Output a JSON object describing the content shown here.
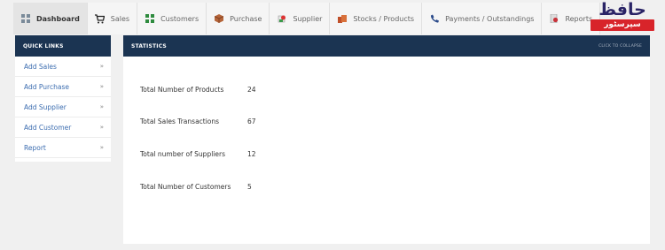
{
  "nav": {
    "tabs": [
      {
        "label": "Dashboard",
        "icon": "dashboard-grid-icon",
        "active": true
      },
      {
        "label": "Sales",
        "icon": "cart-icon"
      },
      {
        "label": "Customers",
        "icon": "customers-icon"
      },
      {
        "label": "Purchase",
        "icon": "box-icon"
      },
      {
        "label": "Supplier",
        "icon": "supplier-icon"
      },
      {
        "label": "Stocks / Products",
        "icon": "stock-boxes-icon"
      },
      {
        "label": "Payments / Outstandings",
        "icon": "phone-icon"
      },
      {
        "label": "Reports",
        "icon": "reports-icon"
      }
    ]
  },
  "logo": {
    "top": "حافظ",
    "bottom": "سپرسٹور"
  },
  "quick_links": {
    "title": "QUICK LINKS",
    "items": [
      {
        "label": "Add Sales",
        "chevron": "»"
      },
      {
        "label": "Add Purchase",
        "chevron": "»"
      },
      {
        "label": "Add Supplier",
        "chevron": "»"
      },
      {
        "label": "Add Customer",
        "chevron": "»"
      },
      {
        "label": "Report",
        "chevron": "»"
      }
    ]
  },
  "statistics": {
    "title": "STATISTICS",
    "collapse_label": "CLICK TO COLLAPSE",
    "rows": [
      {
        "label": "Total Number of Products",
        "value": "24"
      },
      {
        "label": "Total Sales Transactions",
        "value": "67"
      },
      {
        "label": "Total number of Suppliers",
        "value": "12"
      },
      {
        "label": "Total Number of Customers",
        "value": "5"
      }
    ]
  },
  "colors": {
    "header": "#1b3452",
    "link": "#3c6db0",
    "logo_red": "#d8242a",
    "logo_navy": "#2a2466"
  }
}
